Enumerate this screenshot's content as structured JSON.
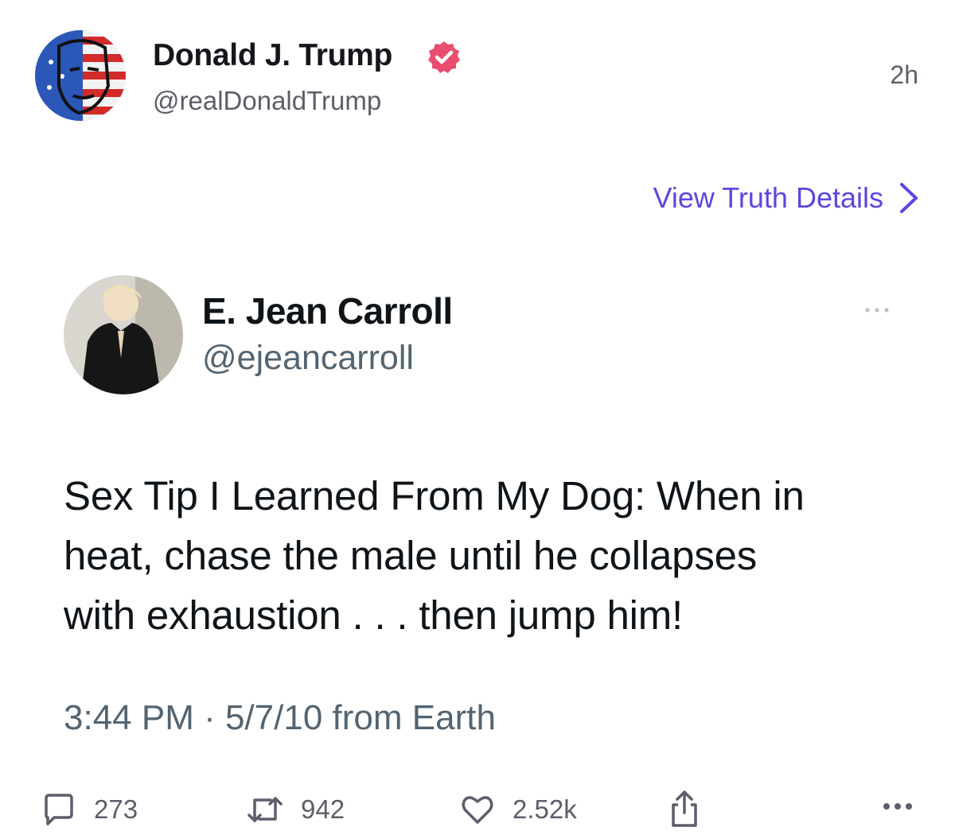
{
  "post": {
    "author_name": "Donald J. Trump",
    "author_handle": "@realDonaldTrump",
    "timestamp": "2h",
    "view_details_label": "View Truth Details"
  },
  "embedded_tweet": {
    "name": "E. Jean Carroll",
    "handle": "@ejeancarroll",
    "lines": [
      "Sex Tip I Learned From My Dog:  When in",
      "heat, chase the male until he collapses",
      "with exhaustion  . . . then jump him!"
    ],
    "meta": "3:44 PM · 5/7/10 from Earth"
  },
  "actions": {
    "replies": "273",
    "retruths": "942",
    "likes": "2.52k"
  },
  "icons": {
    "verified": "verified-badge-icon",
    "chevron": "chevron-right-icon",
    "reply": "speech-bubble-icon",
    "retruth": "repost-arrows-icon",
    "like": "heart-icon",
    "share": "share-icon",
    "more": "more-dots-icon"
  },
  "colors": {
    "accent": "#5b47e0",
    "verified": "#e94e6e",
    "muted": "#5d5d6b"
  }
}
